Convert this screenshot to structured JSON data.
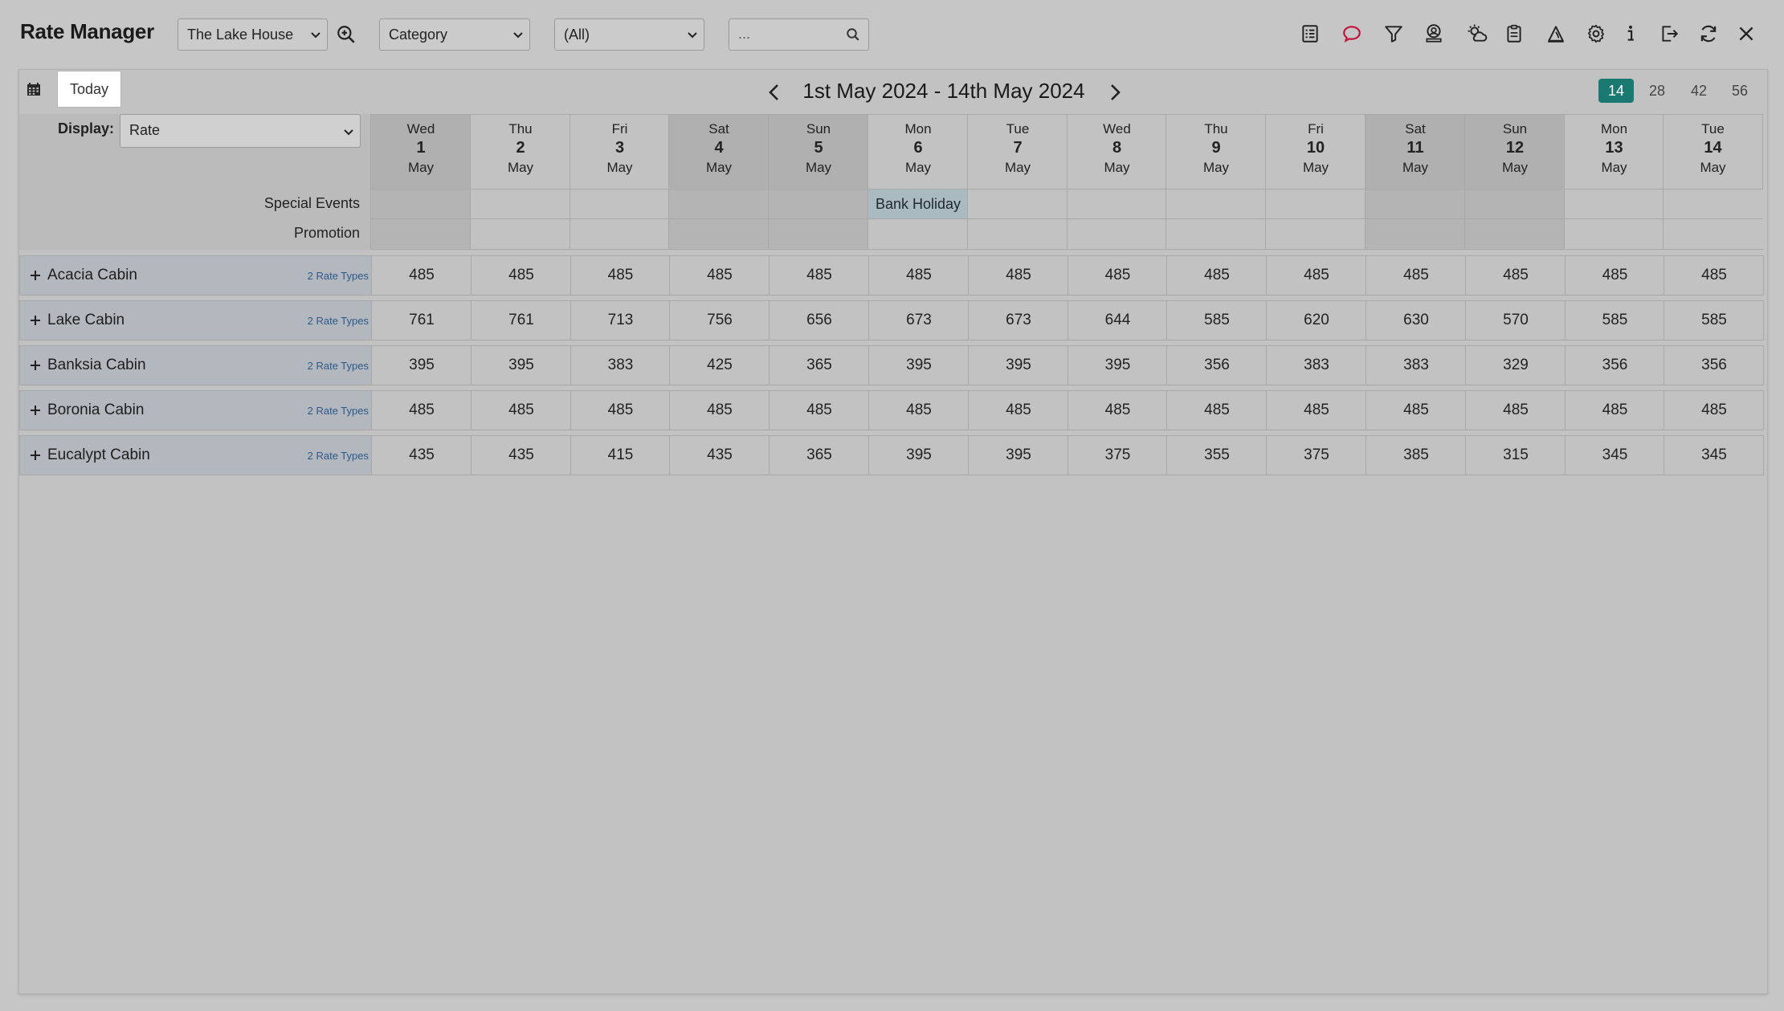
{
  "app_title": "Rate Manager",
  "toolbar": {
    "property": "The Lake House",
    "group_by": "Category",
    "filter": "(All)",
    "search_placeholder": "...",
    "icons": [
      "report-icon",
      "chat-icon",
      "filter-icon",
      "user-account-icon",
      "weather-icon",
      "clipboard-icon",
      "alert-icon",
      "settings-icon",
      "info-icon",
      "exit-icon",
      "refresh-icon",
      "close-icon"
    ]
  },
  "calendar": {
    "today_label": "Today",
    "date_range": "1st May 2024 - 14th May 2024",
    "zoom_options": [
      "14",
      "28",
      "42",
      "56"
    ],
    "active_zoom": "14"
  },
  "display": {
    "label": "Display:",
    "value": "Rate"
  },
  "days": [
    {
      "dow": "Wed",
      "num": "1",
      "month": "May"
    },
    {
      "dow": "Thu",
      "num": "2",
      "month": "May"
    },
    {
      "dow": "Fri",
      "num": "3",
      "month": "May"
    },
    {
      "dow": "Sat",
      "num": "4",
      "month": "May"
    },
    {
      "dow": "Sun",
      "num": "5",
      "month": "May"
    },
    {
      "dow": "Mon",
      "num": "6",
      "month": "May"
    },
    {
      "dow": "Tue",
      "num": "7",
      "month": "May"
    },
    {
      "dow": "Wed",
      "num": "8",
      "month": "May"
    },
    {
      "dow": "Thu",
      "num": "9",
      "month": "May"
    },
    {
      "dow": "Fri",
      "num": "10",
      "month": "May"
    },
    {
      "dow": "Sat",
      "num": "11",
      "month": "May"
    },
    {
      "dow": "Sun",
      "num": "12",
      "month": "May"
    },
    {
      "dow": "Mon",
      "num": "13",
      "month": "May"
    },
    {
      "dow": "Tue",
      "num": "14",
      "month": "May"
    }
  ],
  "special_rows": {
    "special_events_label": "Special Events",
    "promotion_label": "Promotion",
    "special_events": [
      "",
      "",
      "",
      "",
      "",
      "Bank Holiday",
      "",
      "",
      "",
      "",
      "",
      "",
      "",
      ""
    ],
    "promotions": [
      "",
      "",
      "",
      "",
      "",
      "",
      "",
      "",
      "",
      "",
      "",
      "",
      "",
      ""
    ]
  },
  "rooms": [
    {
      "name": "Acacia Cabin",
      "rate_types": "2 Rate Types",
      "rates": [
        "485",
        "485",
        "485",
        "485",
        "485",
        "485",
        "485",
        "485",
        "485",
        "485",
        "485",
        "485",
        "485",
        "485"
      ]
    },
    {
      "name": "Lake Cabin",
      "rate_types": "2 Rate Types",
      "rates": [
        "761",
        "761",
        "713",
        "756",
        "656",
        "673",
        "673",
        "644",
        "585",
        "620",
        "630",
        "570",
        "585",
        "585"
      ]
    },
    {
      "name": "Banksia Cabin",
      "rate_types": "2 Rate Types",
      "rates": [
        "395",
        "395",
        "383",
        "425",
        "365",
        "395",
        "395",
        "395",
        "356",
        "383",
        "383",
        "329",
        "356",
        "356"
      ]
    },
    {
      "name": "Boronia Cabin",
      "rate_types": "2 Rate Types",
      "rates": [
        "485",
        "485",
        "485",
        "485",
        "485",
        "485",
        "485",
        "485",
        "485",
        "485",
        "485",
        "485",
        "485",
        "485"
      ]
    },
    {
      "name": "Eucalypt Cabin",
      "rate_types": "2 Rate Types",
      "rates": [
        "435",
        "435",
        "415",
        "435",
        "365",
        "395",
        "395",
        "375",
        "355",
        "375",
        "385",
        "315",
        "345",
        "345"
      ]
    }
  ],
  "colors": {
    "accent": "#1a7a72",
    "holiday": "#a9bac0",
    "chat_icon": "#c0143c"
  }
}
